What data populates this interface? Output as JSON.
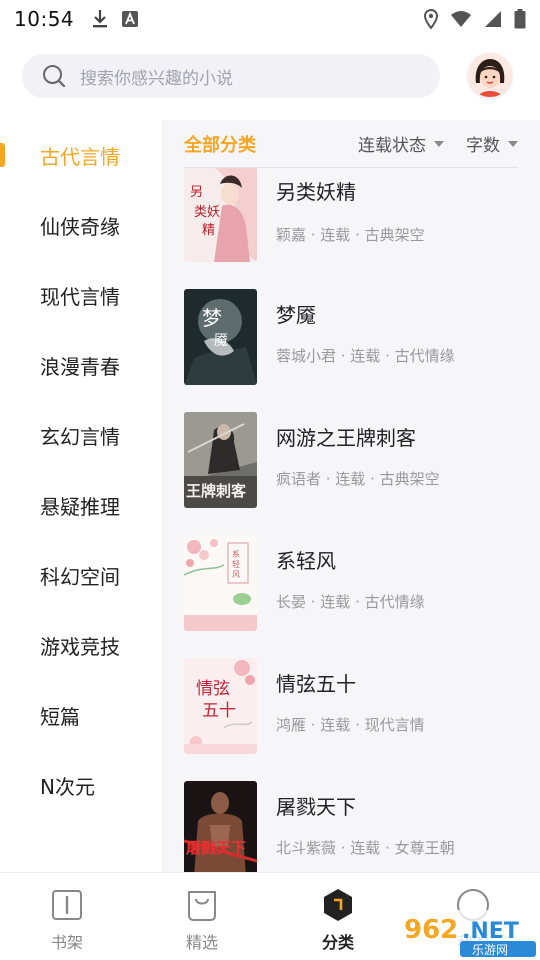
{
  "status_bar": {
    "time": "10:54"
  },
  "header": {
    "search_placeholder": "搜索你感兴趣的小说"
  },
  "sidebar": {
    "items": [
      {
        "label": "古代言情",
        "active": true
      },
      {
        "label": "仙侠奇缘"
      },
      {
        "label": "现代言情"
      },
      {
        "label": "浪漫青春"
      },
      {
        "label": "玄幻言情"
      },
      {
        "label": "悬疑推理"
      },
      {
        "label": "科幻空间"
      },
      {
        "label": "游戏竞技"
      },
      {
        "label": "短篇"
      },
      {
        "label": "N次元"
      }
    ]
  },
  "filters": {
    "all": "全部分类",
    "status": "连载状态",
    "word_count": "字数"
  },
  "books": [
    {
      "title": "另类妖精",
      "meta": "颖嘉 · 连载 · 古典架空"
    },
    {
      "title": "梦魇",
      "meta": "蓉城小君 · 连载 · 古代情缘"
    },
    {
      "title": "网游之王牌刺客",
      "meta": "疯语者 · 连载 · 古典架空"
    },
    {
      "title": "系轻风",
      "meta": "长晏 · 连载 · 古代情缘"
    },
    {
      "title": "情弦五十",
      "meta": "鸿雁 · 连载 · 现代言情"
    },
    {
      "title": "屠戮天下",
      "meta": "北斗紫薇 · 连载 · 女尊王朝"
    }
  ],
  "bottom_nav": {
    "items": [
      {
        "label": "书架"
      },
      {
        "label": "精选"
      },
      {
        "label": "分类",
        "active": true
      },
      {
        "label": "我的"
      }
    ]
  },
  "watermark": {
    "text": "962.NET",
    "subtext": "乐游网"
  },
  "colors": {
    "accent": "#f5a623",
    "text": "#222222",
    "muted": "#999999",
    "panel": "#f6f6f9"
  }
}
